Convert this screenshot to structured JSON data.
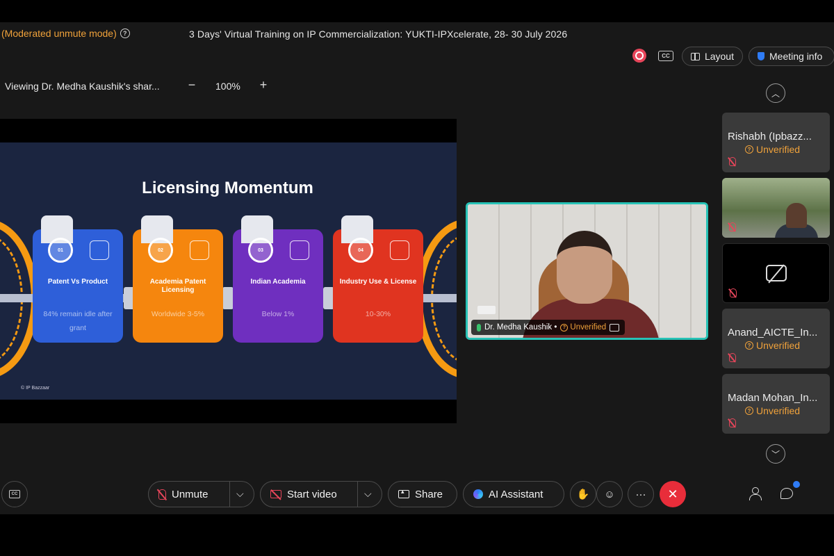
{
  "header": {
    "moderated_label": "(Moderated unmute mode)",
    "meeting_title": "3 Days' Virtual Training on IP Commercialization: YUKTI-IPXcelerate, 28- 30 July 2026",
    "cc_label": "CC",
    "layout_label": "Layout",
    "meeting_info_label": "Meeting info"
  },
  "sharing": {
    "viewing_label": "Viewing Dr. Medha Kaushik's shar...",
    "zoom_minus": "−",
    "zoom_value": "100%",
    "zoom_plus": "+"
  },
  "slide": {
    "title": "Licensing Momentum",
    "cards": [
      {
        "num": "01",
        "title": "Patent Vs Product",
        "sub": "84% remain idle after grant"
      },
      {
        "num": "02",
        "title": "Academia Patent Licensing",
        "sub": "Worldwide 3-5%"
      },
      {
        "num": "03",
        "title": "Indian Academia",
        "sub": "Below 1%"
      },
      {
        "num": "04",
        "title": "Industry Use & License",
        "sub": "10-30%"
      }
    ],
    "credit": "© IP Bazzaar"
  },
  "speaker": {
    "name": "Dr. Medha Kaushik •",
    "status": "Unverified"
  },
  "participants": [
    {
      "name": "Rishabh (Ipbazz...",
      "status": "Unverified"
    },
    {
      "name": "",
      "status": ""
    },
    {
      "name": "",
      "status": ""
    },
    {
      "name": "Anand_AICTE_In...",
      "status": "Unverified"
    },
    {
      "name": "Madan Mohan_In...",
      "status": "Unverified"
    }
  ],
  "controls": {
    "unmute_label": "Unmute",
    "start_video_label": "Start video",
    "share_label": "Share",
    "ai_assistant_label": "AI Assistant",
    "more_label": "···",
    "leave_label": "✕",
    "cc_label": "CC"
  },
  "colors": {
    "accent_orange": "#f0a23a",
    "speaker_border": "#27c2b6",
    "leave_red": "#e82d3a",
    "record_red": "#e7455a"
  }
}
